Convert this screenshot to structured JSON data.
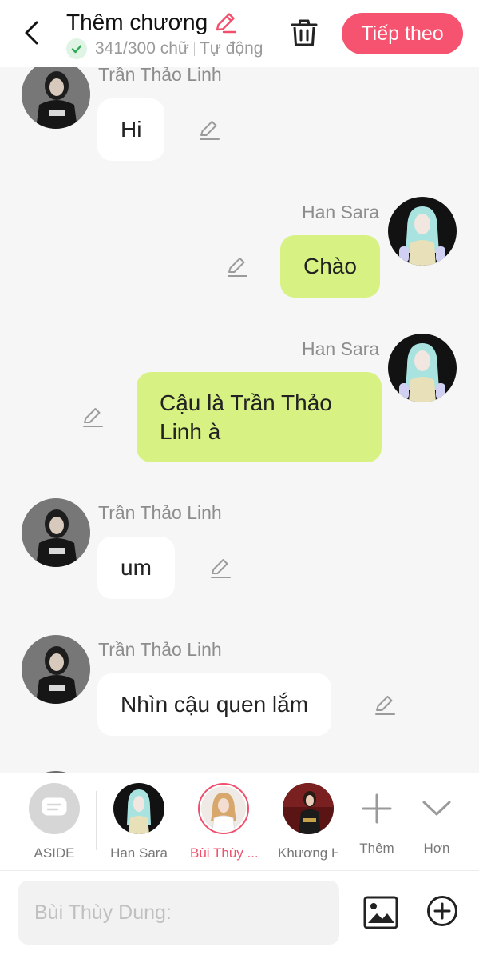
{
  "header": {
    "title": "Thêm chương",
    "word_count": "341/300 chữ",
    "autosave": "Tự động",
    "next_label": "Tiếp theo",
    "accent": "#f5536f"
  },
  "icons": {
    "back": "chevron-left-icon",
    "title_edit": "pencil-icon",
    "check": "check-icon",
    "trash": "trash-icon",
    "message_edit": "pencil-icon",
    "aside": "message-square-icon",
    "add_character": "plus-icon",
    "more": "chevron-down-icon",
    "image": "image-icon",
    "add": "plus-circle-icon"
  },
  "messages": [
    {
      "sender": "Trần Thảo Linh",
      "side": "left",
      "text": "Hi"
    },
    {
      "sender": "Han Sara",
      "side": "right",
      "text": "Chào"
    },
    {
      "sender": "Han Sara",
      "side": "right",
      "text_line1": "Cậu là Trần Thảo",
      "text_line2": "Linh à"
    },
    {
      "sender": "Trần Thảo Linh",
      "side": "left",
      "text": "um"
    },
    {
      "sender": "Trần Thảo Linh",
      "side": "left",
      "text": "Nhìn cậu quen lắm"
    }
  ],
  "character_bar": {
    "aside_label": "ASIDE",
    "characters": [
      {
        "label": "Han Sara"
      },
      {
        "label": "Bùi Thùy ..."
      },
      {
        "label": "Khương H"
      }
    ],
    "add_label": "Thêm",
    "more_label": "Hơn",
    "selected_color": "#f0506b"
  },
  "input": {
    "placeholder": "Bùi Thùy Dung:"
  },
  "colors": {
    "left_bubble": "#ffffff",
    "right_bubble": "#d7f283",
    "background": "#f6f6f6"
  }
}
